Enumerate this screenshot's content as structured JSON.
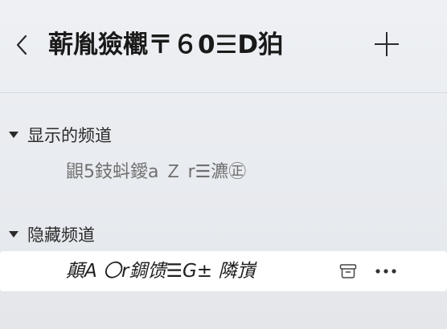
{
  "header": {
    "back_icon": "chevron-left-icon",
    "title": "蕲胤獫欟〒６0☰D狛",
    "add_icon": "plus-icon"
  },
  "sections": {
    "shown": {
      "label": "显示的频道",
      "caret_icon": "caret-down-icon",
      "channels": [
        {
          "name": "鼰5鈘蚪鑀a Ｚ r☰瀌㊣"
        }
      ]
    },
    "hidden": {
      "label": "隐藏频道",
      "caret_icon": "caret-down-icon",
      "channels": [
        {
          "name": "顛A 〇r錭馈☰G± 隣嵿",
          "archive_icon": "archive-box-icon",
          "more_icon": "more-horizontal-icon"
        }
      ]
    }
  }
}
